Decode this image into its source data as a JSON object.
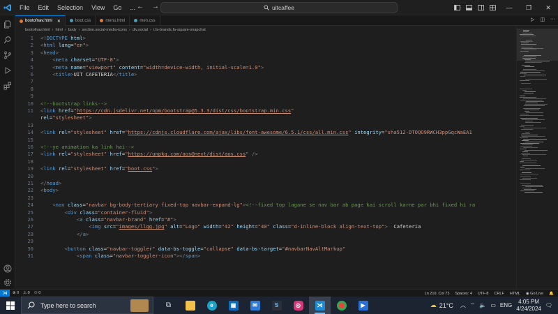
{
  "titlebar": {
    "menu": [
      "File",
      "Edit",
      "Selection",
      "View",
      "Go",
      "..."
    ],
    "search_text": "uitcaffee"
  },
  "tabs": [
    {
      "label": "bootofnav.html",
      "active": true,
      "color": "#e37933"
    },
    {
      "label": "boot.css",
      "active": false,
      "color": "#519aba"
    },
    {
      "label": "menu.html",
      "active": false,
      "color": "#e37933"
    },
    {
      "label": "men.css",
      "active": false,
      "color": "#519aba"
    }
  ],
  "breadcrumb": [
    "bootofnav.html",
    "html",
    "body",
    "section.social-media-icons",
    "div.social",
    "i.fa-brands.fa-square-snapchat"
  ],
  "editor": {
    "lines": [
      {
        "n": "1",
        "segs": [
          [
            "br",
            "<!"
          ],
          [
            "tag",
            "DOCTYPE"
          ],
          [
            "tx",
            " "
          ],
          [
            "at",
            "html"
          ],
          [
            "br",
            ">"
          ]
        ]
      },
      {
        "n": "2",
        "segs": [
          [
            "br",
            "<"
          ],
          [
            "tag",
            "html"
          ],
          [
            "tx",
            " "
          ],
          [
            "at",
            "lang"
          ],
          [
            "tx",
            "="
          ],
          [
            "st",
            "\"en\""
          ],
          [
            "br",
            ">"
          ]
        ]
      },
      {
        "n": "3",
        "segs": [
          [
            "br",
            "<"
          ],
          [
            "tag",
            "head"
          ],
          [
            "br",
            ">"
          ]
        ]
      },
      {
        "n": "4",
        "segs": [
          [
            "tx",
            "    "
          ],
          [
            "br",
            "<"
          ],
          [
            "tag",
            "meta"
          ],
          [
            "tx",
            " "
          ],
          [
            "at",
            "charset"
          ],
          [
            "tx",
            "="
          ],
          [
            "st",
            "\"UTF-8\""
          ],
          [
            "br",
            ">"
          ]
        ]
      },
      {
        "n": "5",
        "segs": [
          [
            "tx",
            "    "
          ],
          [
            "br",
            "<"
          ],
          [
            "tag",
            "meta"
          ],
          [
            "tx",
            " "
          ],
          [
            "at",
            "name"
          ],
          [
            "tx",
            "="
          ],
          [
            "st",
            "\"viewport\""
          ],
          [
            "tx",
            " "
          ],
          [
            "at",
            "content"
          ],
          [
            "tx",
            "="
          ],
          [
            "st",
            "\"width=device-width, initial-scale=1.0\""
          ],
          [
            "br",
            ">"
          ]
        ]
      },
      {
        "n": "6",
        "segs": [
          [
            "tx",
            "    "
          ],
          [
            "br",
            "<"
          ],
          [
            "tag",
            "title"
          ],
          [
            "br",
            ">"
          ],
          [
            "tx",
            "UIT CAFETERIA"
          ],
          [
            "br",
            "</"
          ],
          [
            "tag",
            "title"
          ],
          [
            "br",
            ">"
          ]
        ]
      },
      {
        "n": "7",
        "segs": []
      },
      {
        "n": "8",
        "segs": []
      },
      {
        "n": "9",
        "segs": []
      },
      {
        "n": "10",
        "segs": [
          [
            "cm",
            "<!--bootstrap links-->"
          ]
        ]
      },
      {
        "n": "11",
        "segs": [
          [
            "br",
            "<"
          ],
          [
            "tag",
            "link"
          ],
          [
            "tx",
            " "
          ],
          [
            "at",
            "href"
          ],
          [
            "tx",
            "="
          ],
          [
            "st",
            "\""
          ],
          [
            "stu",
            "https://cdn.jsdelivr.net/npm/bootstrap@5.3.3/dist/css/bootstrap.min.css"
          ],
          [
            "st",
            "\""
          ]
        ]
      },
      {
        "n": "",
        "segs": [
          [
            "at",
            "rel"
          ],
          [
            "tx",
            "="
          ],
          [
            "st",
            "\"stylesheet\""
          ],
          [
            "br",
            ">"
          ]
        ]
      },
      {
        "n": "13",
        "segs": []
      },
      {
        "n": "14",
        "segs": [
          [
            "br",
            "<"
          ],
          [
            "tag",
            "link"
          ],
          [
            "tx",
            " "
          ],
          [
            "at",
            "rel"
          ],
          [
            "tx",
            "="
          ],
          [
            "st",
            "\"stylesheet\""
          ],
          [
            "tx",
            " "
          ],
          [
            "at",
            "href"
          ],
          [
            "tx",
            "="
          ],
          [
            "st",
            "\""
          ],
          [
            "stu",
            "https://cdnjs.cloudflare.com/ajax/libs/font-awesome/6.5.1/css/all.min.css"
          ],
          [
            "st",
            "\""
          ],
          [
            "tx",
            " "
          ],
          [
            "at",
            "integrity"
          ],
          [
            "tx",
            "="
          ],
          [
            "st",
            "\"sha512-DTOQO9RWCH3ppGqcWaEA1"
          ]
        ]
      },
      {
        "n": "15",
        "segs": []
      },
      {
        "n": "16",
        "segs": [
          [
            "cm",
            "<!--ye animation ka link hai-->"
          ]
        ]
      },
      {
        "n": "17",
        "segs": [
          [
            "br",
            "<"
          ],
          [
            "tag",
            "link"
          ],
          [
            "tx",
            " "
          ],
          [
            "at",
            "rel"
          ],
          [
            "tx",
            "="
          ],
          [
            "st",
            "\"stylesheet\""
          ],
          [
            "tx",
            " "
          ],
          [
            "at",
            "href"
          ],
          [
            "tx",
            "="
          ],
          [
            "st",
            "\""
          ],
          [
            "stu",
            "https://unpkg.com/aos@next/dist/aos.css"
          ],
          [
            "st",
            "\""
          ],
          [
            "tx",
            " "
          ],
          [
            "br",
            "/>"
          ]
        ]
      },
      {
        "n": "18",
        "segs": []
      },
      {
        "n": "19",
        "segs": [
          [
            "br",
            "<"
          ],
          [
            "tag",
            "link"
          ],
          [
            "tx",
            " "
          ],
          [
            "at",
            "rel"
          ],
          [
            "tx",
            "="
          ],
          [
            "st",
            "\"stylesheet\""
          ],
          [
            "tx",
            " "
          ],
          [
            "at",
            "href"
          ],
          [
            "tx",
            "="
          ],
          [
            "st",
            "\""
          ],
          [
            "stu",
            "boot.css"
          ],
          [
            "st",
            "\""
          ],
          [
            "br",
            ">"
          ]
        ]
      },
      {
        "n": "20",
        "segs": []
      },
      {
        "n": "21",
        "segs": [
          [
            "br",
            "</"
          ],
          [
            "tag",
            "head"
          ],
          [
            "br",
            ">"
          ]
        ]
      },
      {
        "n": "22",
        "segs": [
          [
            "br",
            "<"
          ],
          [
            "tag",
            "body"
          ],
          [
            "br",
            ">"
          ]
        ]
      },
      {
        "n": "23",
        "segs": []
      },
      {
        "n": "24",
        "segs": [
          [
            "tx",
            "    "
          ],
          [
            "br",
            "<"
          ],
          [
            "tag",
            "nav"
          ],
          [
            "tx",
            " "
          ],
          [
            "at",
            "class"
          ],
          [
            "tx",
            "="
          ],
          [
            "st",
            "\"navbar bg-body-tertiary fixed-top navbar-expand-lg\""
          ],
          [
            "br",
            ">"
          ],
          [
            "cm",
            "<!--fixed top lagane se nav bar ab page kai scroll karne par bhi fixed hi ra"
          ]
        ]
      },
      {
        "n": "25",
        "segs": [
          [
            "tx",
            "        "
          ],
          [
            "br",
            "<"
          ],
          [
            "tag",
            "div"
          ],
          [
            "tx",
            " "
          ],
          [
            "at",
            "class"
          ],
          [
            "tx",
            "="
          ],
          [
            "st",
            "\"container-fluid\""
          ],
          [
            "br",
            ">"
          ]
        ]
      },
      {
        "n": "26",
        "segs": [
          [
            "tx",
            "            "
          ],
          [
            "br",
            "<"
          ],
          [
            "tag",
            "a"
          ],
          [
            "tx",
            " "
          ],
          [
            "at",
            "class"
          ],
          [
            "tx",
            "="
          ],
          [
            "st",
            "\"navbar-brand\""
          ],
          [
            "tx",
            " "
          ],
          [
            "at",
            "href"
          ],
          [
            "tx",
            "="
          ],
          [
            "st",
            "\"#\""
          ],
          [
            "br",
            ">"
          ]
        ]
      },
      {
        "n": "27",
        "segs": [
          [
            "tx",
            "                "
          ],
          [
            "br",
            "<"
          ],
          [
            "tag",
            "img"
          ],
          [
            "tx",
            " "
          ],
          [
            "at",
            "src"
          ],
          [
            "tx",
            "="
          ],
          [
            "st",
            "\""
          ],
          [
            "stu",
            "images/llgg.jpg"
          ],
          [
            "st",
            "\""
          ],
          [
            "tx",
            " "
          ],
          [
            "at",
            "alt"
          ],
          [
            "tx",
            "="
          ],
          [
            "st",
            "\"Logo\""
          ],
          [
            "tx",
            " "
          ],
          [
            "at",
            "width"
          ],
          [
            "tx",
            "="
          ],
          [
            "st",
            "\"42\""
          ],
          [
            "tx",
            " "
          ],
          [
            "at",
            "height"
          ],
          [
            "tx",
            "="
          ],
          [
            "st",
            "\"40\""
          ],
          [
            "tx",
            " "
          ],
          [
            "at",
            "class"
          ],
          [
            "tx",
            "="
          ],
          [
            "st",
            "\"d-inline-block align-text-top\""
          ],
          [
            "br",
            ">"
          ],
          [
            "tx",
            "  Cafeteria"
          ]
        ]
      },
      {
        "n": "28",
        "segs": [
          [
            "tx",
            "            "
          ],
          [
            "br",
            "</"
          ],
          [
            "tag",
            "a"
          ],
          [
            "br",
            ">"
          ]
        ]
      },
      {
        "n": "29",
        "segs": []
      },
      {
        "n": "30",
        "segs": [
          [
            "tx",
            "        "
          ],
          [
            "br",
            "<"
          ],
          [
            "tag",
            "button"
          ],
          [
            "tx",
            " "
          ],
          [
            "at",
            "class"
          ],
          [
            "tx",
            "="
          ],
          [
            "st",
            "\"navbar-toggler\""
          ],
          [
            "tx",
            " "
          ],
          [
            "at",
            "data-bs-toggle"
          ],
          [
            "tx",
            "="
          ],
          [
            "st",
            "\"collapse\""
          ],
          [
            "tx",
            " "
          ],
          [
            "at",
            "data-bs-target"
          ],
          [
            "tx",
            "="
          ],
          [
            "st",
            "\"#navbarNavAltMarkup\""
          ]
        ]
      },
      {
        "n": "31",
        "segs": [
          [
            "tx",
            "            "
          ],
          [
            "br",
            "<"
          ],
          [
            "tag",
            "span"
          ],
          [
            "tx",
            " "
          ],
          [
            "at",
            "class"
          ],
          [
            "tx",
            "="
          ],
          [
            "st",
            "\"navbar-toggler-icon\""
          ],
          [
            "br",
            "></"
          ],
          [
            "tag",
            "span"
          ],
          [
            "br",
            ">"
          ]
        ]
      }
    ]
  },
  "statusbar": {
    "left": [
      "⊗ 0",
      "⚠ 0",
      "⚇ 0"
    ],
    "right": [
      "Ln 210, Col 73",
      "Spaces: 4",
      "UTF-8",
      "CRLF",
      "HTML",
      "Go Live"
    ]
  },
  "taskbar": {
    "search_placeholder": "Type here to search",
    "weather": "21°C",
    "lang": "ENG",
    "time": "4:05 PM",
    "date": "4/24/2024"
  }
}
